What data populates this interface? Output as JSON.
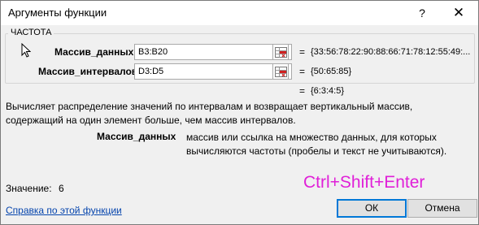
{
  "window": {
    "title": "Аргументы функции",
    "help_label": "?",
    "close_label": "✕"
  },
  "function": {
    "name": "ЧАСТОТА"
  },
  "args": [
    {
      "label": "Массив_данных",
      "value": "B3:B20",
      "result": "{33:56:78:22:90:88:66:71:78:12:55:49:..."
    },
    {
      "label": "Массив_интервалов",
      "value": "D3:D5",
      "result": "{50:65:85}"
    }
  ],
  "equals": "=",
  "overall_result": "{6:3:4:5}",
  "description": "Вычисляет распределение значений по интервалам и возвращает вертикальный массив, содержащий на один элемент больше, чем массив интервалов.",
  "arg_help": {
    "name": "Массив_данных",
    "text": "массив или ссылка на множество данных, для которых вычисляются частоты (пробелы и текст не учитываются)."
  },
  "value": {
    "label": "Значение:",
    "number": "6"
  },
  "annotation": "Ctrl+Shift+Enter",
  "help_link": "Справка по этой функции",
  "buttons": {
    "ok": "ОК",
    "cancel": "Отмена"
  },
  "colors": {
    "annotation": "#e020d8",
    "accent": "#0078d7",
    "link": "#0645ad"
  }
}
